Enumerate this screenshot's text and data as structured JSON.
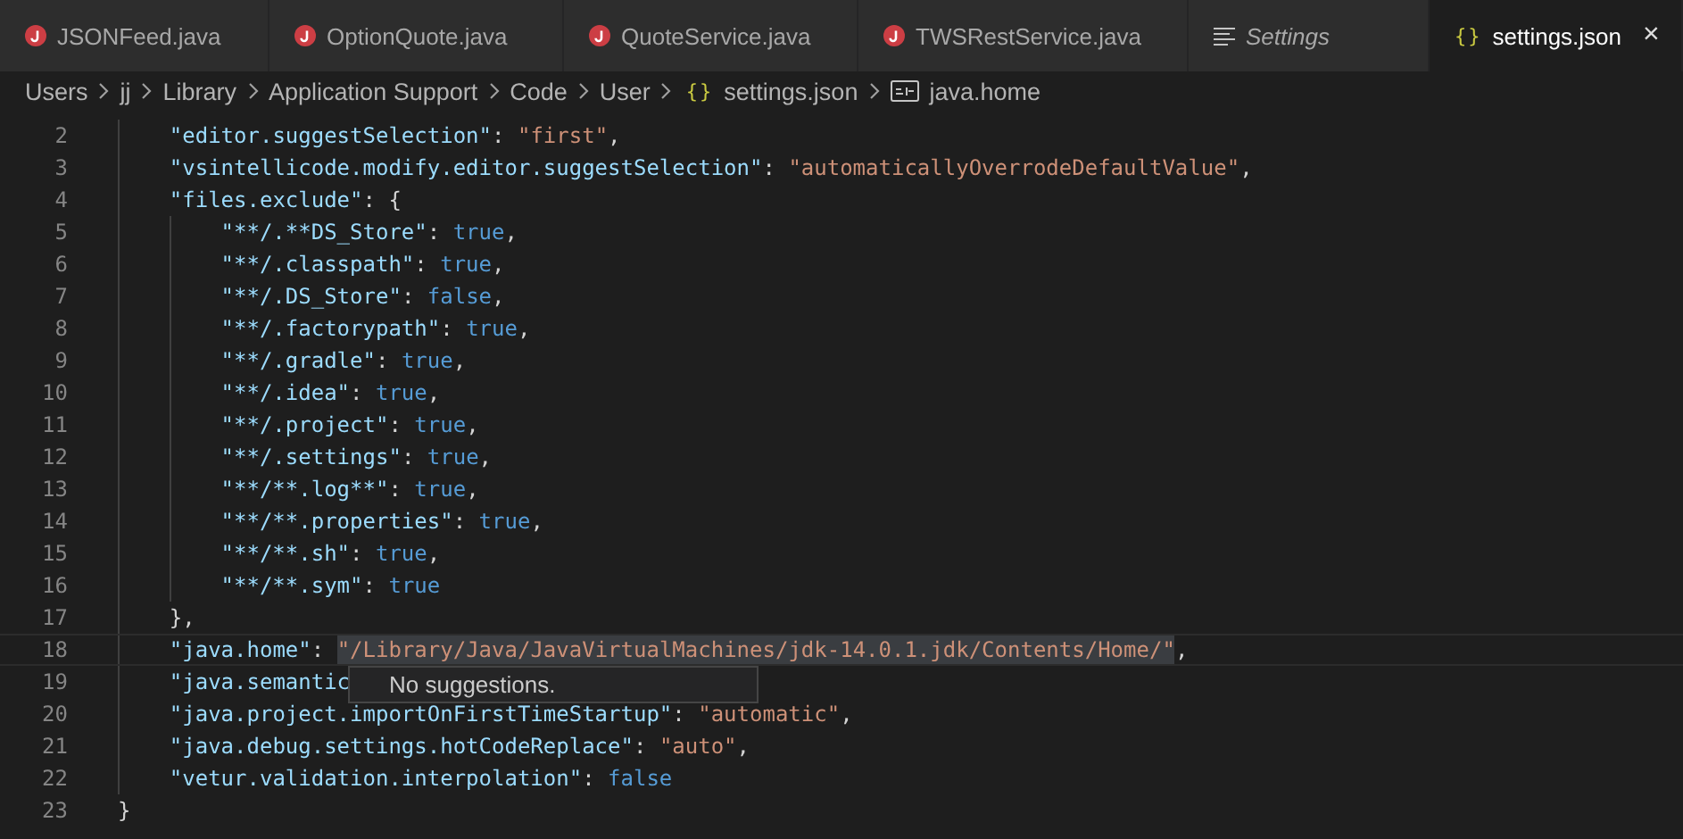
{
  "tabs": [
    {
      "label": "JSONFeed.java",
      "kind": "java",
      "selected": false,
      "preview": false
    },
    {
      "label": "OptionQuote.java",
      "kind": "java",
      "selected": false,
      "preview": false
    },
    {
      "label": "QuoteService.java",
      "kind": "java",
      "selected": false,
      "preview": false
    },
    {
      "label": "TWSRestService.java",
      "kind": "java",
      "selected": false,
      "preview": false
    },
    {
      "label": "Settings",
      "kind": "settings",
      "selected": false,
      "preview": true
    },
    {
      "label": "settings.json",
      "kind": "json",
      "glyph": "{}",
      "selected": true,
      "preview": false,
      "close": "×"
    }
  ],
  "breadcrumbs": [
    {
      "label": "Users",
      "kind": "folder"
    },
    {
      "label": "jj",
      "kind": "folder"
    },
    {
      "label": "Library",
      "kind": "folder"
    },
    {
      "label": "Application Support",
      "kind": "folder"
    },
    {
      "label": "Code",
      "kind": "folder"
    },
    {
      "label": "User",
      "kind": "folder"
    },
    {
      "label": "settings.json",
      "kind": "json",
      "glyph": "{}"
    },
    {
      "label": "java.home",
      "kind": "string"
    }
  ],
  "lines": [
    {
      "number": "2",
      "kind": "member",
      "current": false,
      "tokens": [
        {
          "kind": "key",
          "s": "\"editor.suggestSelection\""
        },
        {
          "kind": "punct",
          "s": ":"
        },
        {
          "kind": "str",
          "s": "\"first\""
        },
        {
          "kind": "punct",
          "s": ","
        }
      ]
    },
    {
      "number": "3",
      "kind": "member",
      "current": false,
      "tokens": [
        {
          "kind": "key",
          "s": "\"vsintellicode.modify.editor.suggestSelection\""
        },
        {
          "kind": "punct",
          "s": ":"
        },
        {
          "kind": "str",
          "s": "\"automaticallyOverrodeDefaultValue\""
        },
        {
          "kind": "punct",
          "s": ","
        }
      ]
    },
    {
      "number": "4",
      "kind": "member",
      "current": false,
      "tokens": [
        {
          "kind": "key",
          "s": "\"files.exclude\""
        },
        {
          "kind": "punct",
          "s": ":"
        },
        {
          "kind": "punct",
          "s": "{"
        }
      ]
    },
    {
      "number": "5",
      "kind": "inner",
      "current": false,
      "tokens": [
        {
          "kind": "key",
          "s": "\"**/.**DS_Store\""
        },
        {
          "kind": "punct",
          "s": ":"
        },
        {
          "kind": "bool",
          "s": "true"
        },
        {
          "kind": "punct",
          "s": ","
        }
      ]
    },
    {
      "number": "6",
      "kind": "inner",
      "current": false,
      "tokens": [
        {
          "kind": "key",
          "s": "\"**/.classpath\""
        },
        {
          "kind": "punct",
          "s": ":"
        },
        {
          "kind": "bool",
          "s": "true"
        },
        {
          "kind": "punct",
          "s": ","
        }
      ]
    },
    {
      "number": "7",
      "kind": "inner",
      "current": false,
      "tokens": [
        {
          "kind": "key",
          "s": "\"**/.DS_Store\""
        },
        {
          "kind": "punct",
          "s": ":"
        },
        {
          "kind": "bool",
          "s": "false"
        },
        {
          "kind": "punct",
          "s": ","
        }
      ]
    },
    {
      "number": "8",
      "kind": "inner",
      "current": false,
      "tokens": [
        {
          "kind": "key",
          "s": "\"**/.factorypath\""
        },
        {
          "kind": "punct",
          "s": ":"
        },
        {
          "kind": "bool",
          "s": "true"
        },
        {
          "kind": "punct",
          "s": ","
        }
      ]
    },
    {
      "number": "9",
      "kind": "inner",
      "current": false,
      "tokens": [
        {
          "kind": "key",
          "s": "\"**/.gradle\""
        },
        {
          "kind": "punct",
          "s": ":"
        },
        {
          "kind": "bool",
          "s": "true"
        },
        {
          "kind": "punct",
          "s": ","
        }
      ]
    },
    {
      "number": "10",
      "kind": "inner",
      "current": false,
      "tokens": [
        {
          "kind": "key",
          "s": "\"**/.idea\""
        },
        {
          "kind": "punct",
          "s": ":"
        },
        {
          "kind": "bool",
          "s": "true"
        },
        {
          "kind": "punct",
          "s": ","
        }
      ]
    },
    {
      "number": "11",
      "kind": "inner",
      "current": false,
      "tokens": [
        {
          "kind": "key",
          "s": "\"**/.project\""
        },
        {
          "kind": "punct",
          "s": ":"
        },
        {
          "kind": "bool",
          "s": "true"
        },
        {
          "kind": "punct",
          "s": ","
        }
      ]
    },
    {
      "number": "12",
      "kind": "inner",
      "current": false,
      "tokens": [
        {
          "kind": "key",
          "s": "\"**/.settings\""
        },
        {
          "kind": "punct",
          "s": ":"
        },
        {
          "kind": "bool",
          "s": "true"
        },
        {
          "kind": "punct",
          "s": ","
        }
      ]
    },
    {
      "number": "13",
      "kind": "inner",
      "current": false,
      "tokens": [
        {
          "kind": "key",
          "s": "\"**/**.log**\""
        },
        {
          "kind": "punct",
          "s": ":"
        },
        {
          "kind": "bool",
          "s": "true"
        },
        {
          "kind": "punct",
          "s": ","
        }
      ]
    },
    {
      "number": "14",
      "kind": "inner",
      "current": false,
      "tokens": [
        {
          "kind": "key",
          "s": "\"**/**.properties\""
        },
        {
          "kind": "punct",
          "s": ":"
        },
        {
          "kind": "bool",
          "s": "true"
        },
        {
          "kind": "punct",
          "s": ","
        }
      ]
    },
    {
      "number": "15",
      "kind": "inner",
      "current": false,
      "tokens": [
        {
          "kind": "key",
          "s": "\"**/**.sh\""
        },
        {
          "kind": "punct",
          "s": ":"
        },
        {
          "kind": "bool",
          "s": "true"
        },
        {
          "kind": "punct",
          "s": ","
        }
      ]
    },
    {
      "number": "16",
      "kind": "inner",
      "current": false,
      "tokens": [
        {
          "kind": "key",
          "s": "\"**/**.sym\""
        },
        {
          "kind": "punct",
          "s": ":"
        },
        {
          "kind": "bool",
          "s": "true"
        }
      ]
    },
    {
      "number": "17",
      "kind": "member",
      "current": false,
      "tokens": [
        {
          "kind": "punct",
          "s": "},"
        }
      ]
    },
    {
      "number": "18",
      "kind": "member",
      "current": true,
      "tokens": [
        {
          "kind": "key",
          "s": "\"java.home\""
        },
        {
          "kind": "punct",
          "s": ":"
        },
        {
          "kind": "str",
          "s": "\"/Library/Java/JavaVirtualMachines/jdk-14.0.1.jdk/Contents/Home/\"",
          "highlighted": true
        },
        {
          "kind": "punct",
          "s": ","
        }
      ]
    },
    {
      "number": "19",
      "kind": "member",
      "current": false,
      "tokens": [
        {
          "kind": "key",
          "s": "\"java.semantic"
        }
      ]
    },
    {
      "number": "20",
      "kind": "member",
      "current": false,
      "tokens": [
        {
          "kind": "key",
          "s": "\"java.project.importOnFirstTimeStartup\""
        },
        {
          "kind": "punct",
          "s": ":"
        },
        {
          "kind": "str",
          "s": "\"automatic\""
        },
        {
          "kind": "punct",
          "s": ","
        }
      ]
    },
    {
      "number": "21",
      "kind": "member",
      "current": false,
      "tokens": [
        {
          "kind": "key",
          "s": "\"java.debug.settings.hotCodeReplace\""
        },
        {
          "kind": "punct",
          "s": ":"
        },
        {
          "kind": "str",
          "s": "\"auto\""
        },
        {
          "kind": "punct",
          "s": ","
        }
      ]
    },
    {
      "number": "22",
      "kind": "member",
      "current": false,
      "tokens": [
        {
          "kind": "key",
          "s": "\"vetur.validation.interpolation\""
        },
        {
          "kind": "punct",
          "s": ":"
        },
        {
          "kind": "bool",
          "s": "false"
        }
      ]
    },
    {
      "number": "23",
      "kind": "root",
      "current": false,
      "tokens": [
        {
          "kind": "punct",
          "s": "}"
        }
      ]
    }
  ],
  "suggest_widget": {
    "message": "No suggestions."
  }
}
